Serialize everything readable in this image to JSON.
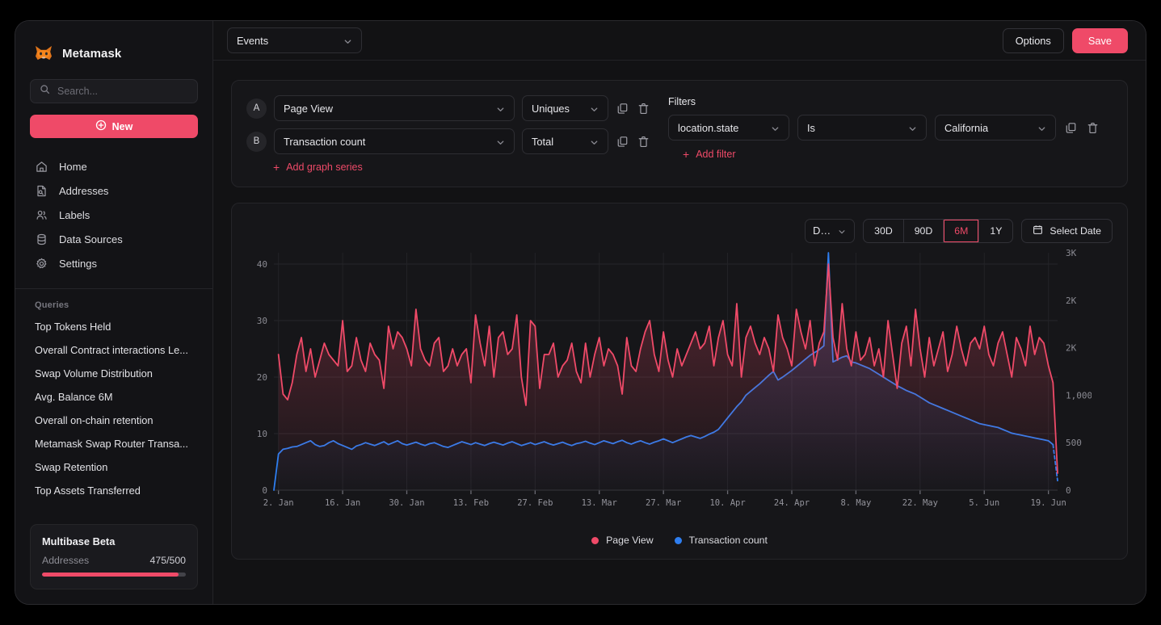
{
  "sidebar": {
    "brand": "Metamask",
    "brand_icon": "fox-icon",
    "search": {
      "placeholder": "Search...",
      "value": "",
      "icon": "search-icon"
    },
    "new_button": {
      "label": "New",
      "icon": "plus-circle-icon"
    },
    "nav": [
      {
        "label": "Home",
        "icon": "home-icon"
      },
      {
        "label": "Addresses",
        "icon": "document-search-icon"
      },
      {
        "label": "Labels",
        "icon": "users-icon"
      },
      {
        "label": "Data Sources",
        "icon": "database-icon"
      },
      {
        "label": "Settings",
        "icon": "gear-icon"
      }
    ],
    "queries_heading": "Queries",
    "queries": [
      "Top Tokens Held",
      "Overall Contract interactions Le...",
      "Swap Volume Distribution",
      "Avg. Balance 6M",
      "Overall on-chain retention",
      "Metamask Swap Router Transa...",
      "Swap Retention",
      "Top Assets Transferred"
    ],
    "beta_card": {
      "title": "Multibase Beta",
      "metric_label": "Addresses",
      "metric_value": "475/500",
      "progress_percent": 95
    }
  },
  "topbar": {
    "events_select": "Events",
    "options_button": "Options",
    "save_button": "Save"
  },
  "builder": {
    "series": [
      {
        "badge": "A",
        "event": "Page View",
        "aggregation": "Uniques",
        "duplicate_icon": "copy-icon",
        "delete_icon": "trash-icon"
      },
      {
        "badge": "B",
        "event": "Transaction count",
        "aggregation": "Total",
        "duplicate_icon": "copy-icon",
        "delete_icon": "trash-icon"
      }
    ],
    "add_series_label": "Add graph series",
    "filters_label": "Filters",
    "filters": [
      {
        "property": "location.state",
        "operator": "Is",
        "value": "California",
        "duplicate_icon": "copy-icon",
        "delete_icon": "trash-icon"
      }
    ],
    "add_filter_label": "Add filter"
  },
  "chart_toolbar": {
    "granularity": "Daily",
    "ranges": [
      {
        "label": "30D",
        "active": false
      },
      {
        "label": "90D",
        "active": false
      },
      {
        "label": "6M",
        "active": true
      },
      {
        "label": "1Y",
        "active": false
      }
    ],
    "select_date": {
      "label": "Select Date",
      "icon": "calendar-icon"
    }
  },
  "chart_data": {
    "type": "line",
    "title": "",
    "xlabel": "",
    "ylabel": "",
    "grid": true,
    "legend_position": "bottom",
    "x_tick_labels": [
      "2. Jan",
      "16. Jan",
      "30. Jan",
      "13. Feb",
      "27. Feb",
      "13. Mar",
      "27. Mar",
      "10. Apr",
      "24. Apr",
      "8. May",
      "22. May",
      "5. Jun",
      "19. Jun"
    ],
    "x_tick_indices": [
      1,
      15,
      29,
      43,
      57,
      71,
      85,
      99,
      113,
      127,
      141,
      155,
      169
    ],
    "left_axis": {
      "label": "Page View",
      "ticks": [
        "0",
        "10",
        "20",
        "30",
        "40"
      ],
      "ylim": [
        0,
        42
      ]
    },
    "right_axis": {
      "label": "Transaction count",
      "ticks": [
        "0",
        "500",
        "1,000",
        "2K",
        "2K",
        "3K"
      ],
      "ylim": [
        0,
        42
      ]
    },
    "series": [
      {
        "name": "Page View",
        "color": "#ef4a68",
        "axis": "left",
        "area_fill": true,
        "values": [
          null,
          24,
          17,
          16,
          19,
          24,
          27,
          21,
          25,
          20,
          23,
          26,
          24,
          23,
          22,
          30,
          21,
          22,
          27,
          23,
          21,
          26,
          24,
          23,
          18,
          29,
          25,
          28,
          27,
          25,
          22,
          32,
          25,
          23,
          22,
          26,
          27,
          21,
          22,
          25,
          22,
          24,
          25,
          19,
          31,
          26,
          22,
          29,
          20,
          27,
          28,
          24,
          25,
          31,
          20,
          15,
          30,
          29,
          18,
          24,
          24,
          26,
          20,
          22,
          23,
          26,
          21,
          19,
          26,
          20,
          24,
          27,
          22,
          25,
          24,
          22,
          17,
          27,
          22,
          21,
          25,
          28,
          30,
          24,
          21,
          28,
          23,
          20,
          25,
          22,
          24,
          26,
          28,
          25,
          26,
          29,
          22,
          27,
          30,
          24,
          22,
          33,
          20,
          27,
          29,
          26,
          24,
          27,
          25,
          21,
          31,
          27,
          25,
          22,
          32,
          28,
          25,
          30,
          22,
          26,
          28,
          40,
          27,
          23,
          33,
          25,
          22,
          28,
          23,
          24,
          27,
          22,
          25,
          20,
          30,
          24,
          18,
          26,
          29,
          22,
          32,
          25,
          20,
          27,
          22,
          25,
          28,
          21,
          24,
          29,
          25,
          22,
          26,
          27,
          25,
          29,
          24,
          22,
          26,
          28,
          24,
          20,
          27,
          25,
          22,
          29,
          24,
          27,
          26,
          22,
          19,
          3
        ]
      },
      {
        "name": "Transaction count",
        "color": "#2e7ef0",
        "axis": "right",
        "dashed_tail": true,
        "values": [
          0,
          380,
          430,
          440,
          455,
          460,
          480,
          500,
          520,
          480,
          460,
          470,
          500,
          520,
          490,
          470,
          450,
          430,
          465,
          480,
          500,
          485,
          470,
          490,
          510,
          480,
          500,
          520,
          490,
          475,
          490,
          505,
          485,
          470,
          490,
          500,
          480,
          460,
          450,
          470,
          490,
          510,
          495,
          480,
          500,
          485,
          470,
          490,
          505,
          490,
          475,
          495,
          510,
          490,
          470,
          485,
          500,
          480,
          495,
          510,
          490,
          475,
          490,
          505,
          485,
          470,
          490,
          500,
          515,
          495,
          480,
          500,
          520,
          505,
          490,
          510,
          525,
          500,
          485,
          505,
          520,
          500,
          485,
          505,
          520,
          540,
          520,
          500,
          520,
          540,
          560,
          575,
          560,
          545,
          565,
          590,
          610,
          640,
          700,
          760,
          820,
          880,
          930,
          1000,
          1080,
          1160,
          1240,
          1330,
          1420,
          1500,
          1320,
          1380,
          1450,
          1520,
          1600,
          1680,
          1760,
          1840,
          1900,
          1960,
          2020,
          3000,
          1700,
          1750,
          1800,
          1830,
          1700,
          1680,
          1640,
          1600,
          1560,
          1500,
          1440,
          1380,
          1320,
          1260,
          1200,
          1150,
          1100,
          1060,
          1020,
          980,
          950,
          920,
          900,
          880,
          860,
          840,
          820,
          800,
          780,
          760,
          740,
          720,
          700,
          690,
          680,
          670,
          660,
          640,
          620,
          600,
          590,
          580,
          570,
          560,
          550,
          540,
          530,
          520,
          480,
          100
        ]
      }
    ]
  },
  "legend": [
    {
      "label": "Page View",
      "color": "#ef4a68"
    },
    {
      "label": "Transaction count",
      "color": "#2e7ef0"
    }
  ]
}
